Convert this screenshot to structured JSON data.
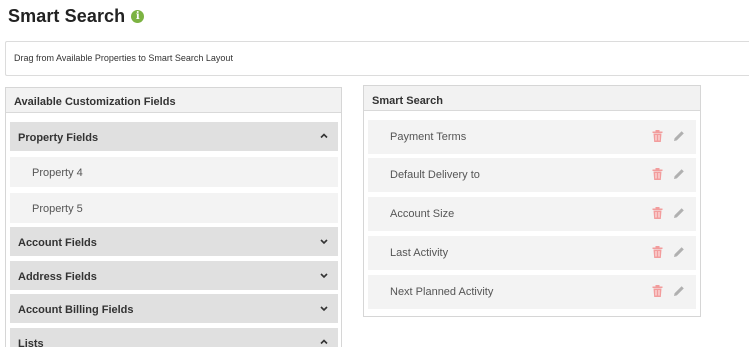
{
  "page": {
    "title": "Smart Search",
    "info_icon": "info-icon",
    "instructions": "Drag from Available Properties to Smart Search Layout"
  },
  "colors": {
    "info_icon": "#7cb342",
    "trash_icon": "#f29c9c",
    "pencil_icon": "#b0b0b0",
    "group_header_bg": "#e0e0e0",
    "item_bg": "#f3f3f3"
  },
  "available": {
    "header": "Available Customization Fields",
    "groups": [
      {
        "label": "Property Fields",
        "state": "expanded",
        "chevron": "chevron-up-icon",
        "items": [
          {
            "label": "Property 4"
          },
          {
            "label": "Property 5"
          }
        ]
      },
      {
        "label": "Account Fields",
        "state": "collapsed",
        "chevron": "chevron-down-icon"
      },
      {
        "label": "Address Fields",
        "state": "collapsed",
        "chevron": "chevron-down-icon"
      },
      {
        "label": "Account Billing Fields",
        "state": "collapsed",
        "chevron": "chevron-down-icon"
      },
      {
        "label": "Lists",
        "state": "expanded",
        "chevron": "chevron-up-icon"
      }
    ]
  },
  "smart_search": {
    "header": "Smart Search",
    "items": [
      {
        "label": "Payment Terms",
        "icons": [
          "trash-icon",
          "pencil-icon"
        ]
      },
      {
        "label": "Default Delivery to",
        "icons": [
          "trash-icon",
          "pencil-icon"
        ]
      },
      {
        "label": "Account Size",
        "icons": [
          "trash-icon",
          "pencil-icon"
        ]
      },
      {
        "label": "Last Activity",
        "icons": [
          "trash-icon",
          "pencil-icon"
        ]
      },
      {
        "label": "Next Planned Activity",
        "icons": [
          "trash-icon",
          "pencil-icon"
        ]
      }
    ]
  }
}
